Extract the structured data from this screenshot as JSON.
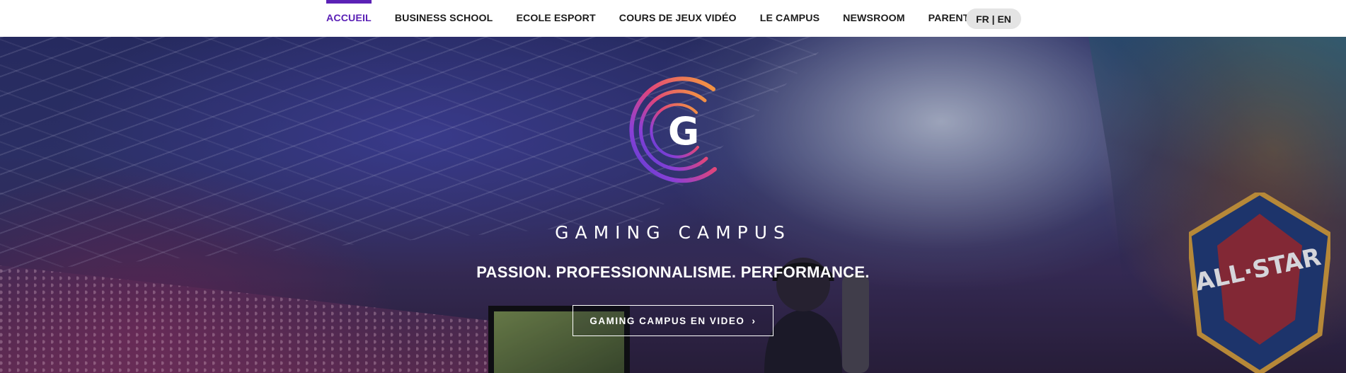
{
  "nav": {
    "items": [
      {
        "label": "ACCUEIL",
        "active": true
      },
      {
        "label": "BUSINESS SCHOOL",
        "active": false
      },
      {
        "label": "ECOLE ESPORT",
        "active": false
      },
      {
        "label": "COURS DE JEUX VIDÉO",
        "active": false
      },
      {
        "label": "LE CAMPUS",
        "active": false
      },
      {
        "label": "NEWSROOM",
        "active": false
      },
      {
        "label": "PARENTS",
        "active": false
      }
    ],
    "language": "FR | EN",
    "accent_color": "#5b21b6"
  },
  "hero": {
    "logo_letter": "G",
    "brand_name": "GAMING CAMPUS",
    "tagline": "PASSION. PROFESSIONNALISME. PERFORMANCE.",
    "cta_label": "GAMING CAMPUS EN VIDEO",
    "cta_icon": "chevron-right-icon",
    "logo_gradient": [
      "#f59e3b",
      "#e0457b",
      "#8b3fd6",
      "#4c3fd0"
    ]
  }
}
